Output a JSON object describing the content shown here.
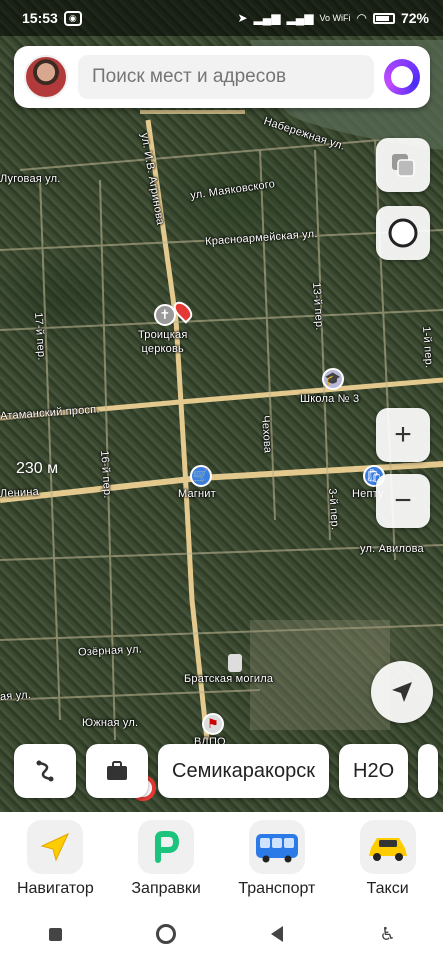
{
  "status_bar": {
    "time": "15:53",
    "battery": "72%",
    "net": "Vo WiFi"
  },
  "search": {
    "placeholder": "Поиск мест и адресов"
  },
  "map": {
    "labels": {
      "naberezhnaya": "Набережная ул.",
      "lugovaya": "Луговая ул.",
      "mayakovskogo": "ул. Маяковского",
      "krasnoarmeyskaya": "Красноармейская ул.",
      "agrinova": "ул. И.В. Агринова",
      "first_per": "1-й пер.",
      "thirteenth_per": "13-й пер.",
      "seventeenth_per": "17-й пер.",
      "atamanskiy": "Атаманский просп.",
      "chekhova": "Чехова",
      "lenina": "Ленина",
      "avilova": "ул. Авилова",
      "ozernaya": "Озёрная ул.",
      "yuzhnaya": "Южная ул.",
      "third_per": "3-й пер.",
      "sixteenth_per": "16-й пер.",
      "kolkhoznaya": "ая ул."
    },
    "poi": {
      "church": "Троицкая\nцерковь",
      "school": "Школа № 3",
      "magnit": "Магнит",
      "neptun": "Непту",
      "bratskaya": "Братская могила",
      "vdpo": "ВДПО"
    },
    "scale": "230 м"
  },
  "chips": {
    "city": "Семикаракорск",
    "h2o": "H2O"
  },
  "bottom_tiles": [
    {
      "label": "Навигатор"
    },
    {
      "label": "Заправки"
    },
    {
      "label": "Транспорт"
    },
    {
      "label": "Такси"
    }
  ],
  "colors": {
    "road": "#e8c98a",
    "accent": "#8b3cff",
    "taxi": "#ffcc00",
    "fuel": "#1bc47d"
  }
}
